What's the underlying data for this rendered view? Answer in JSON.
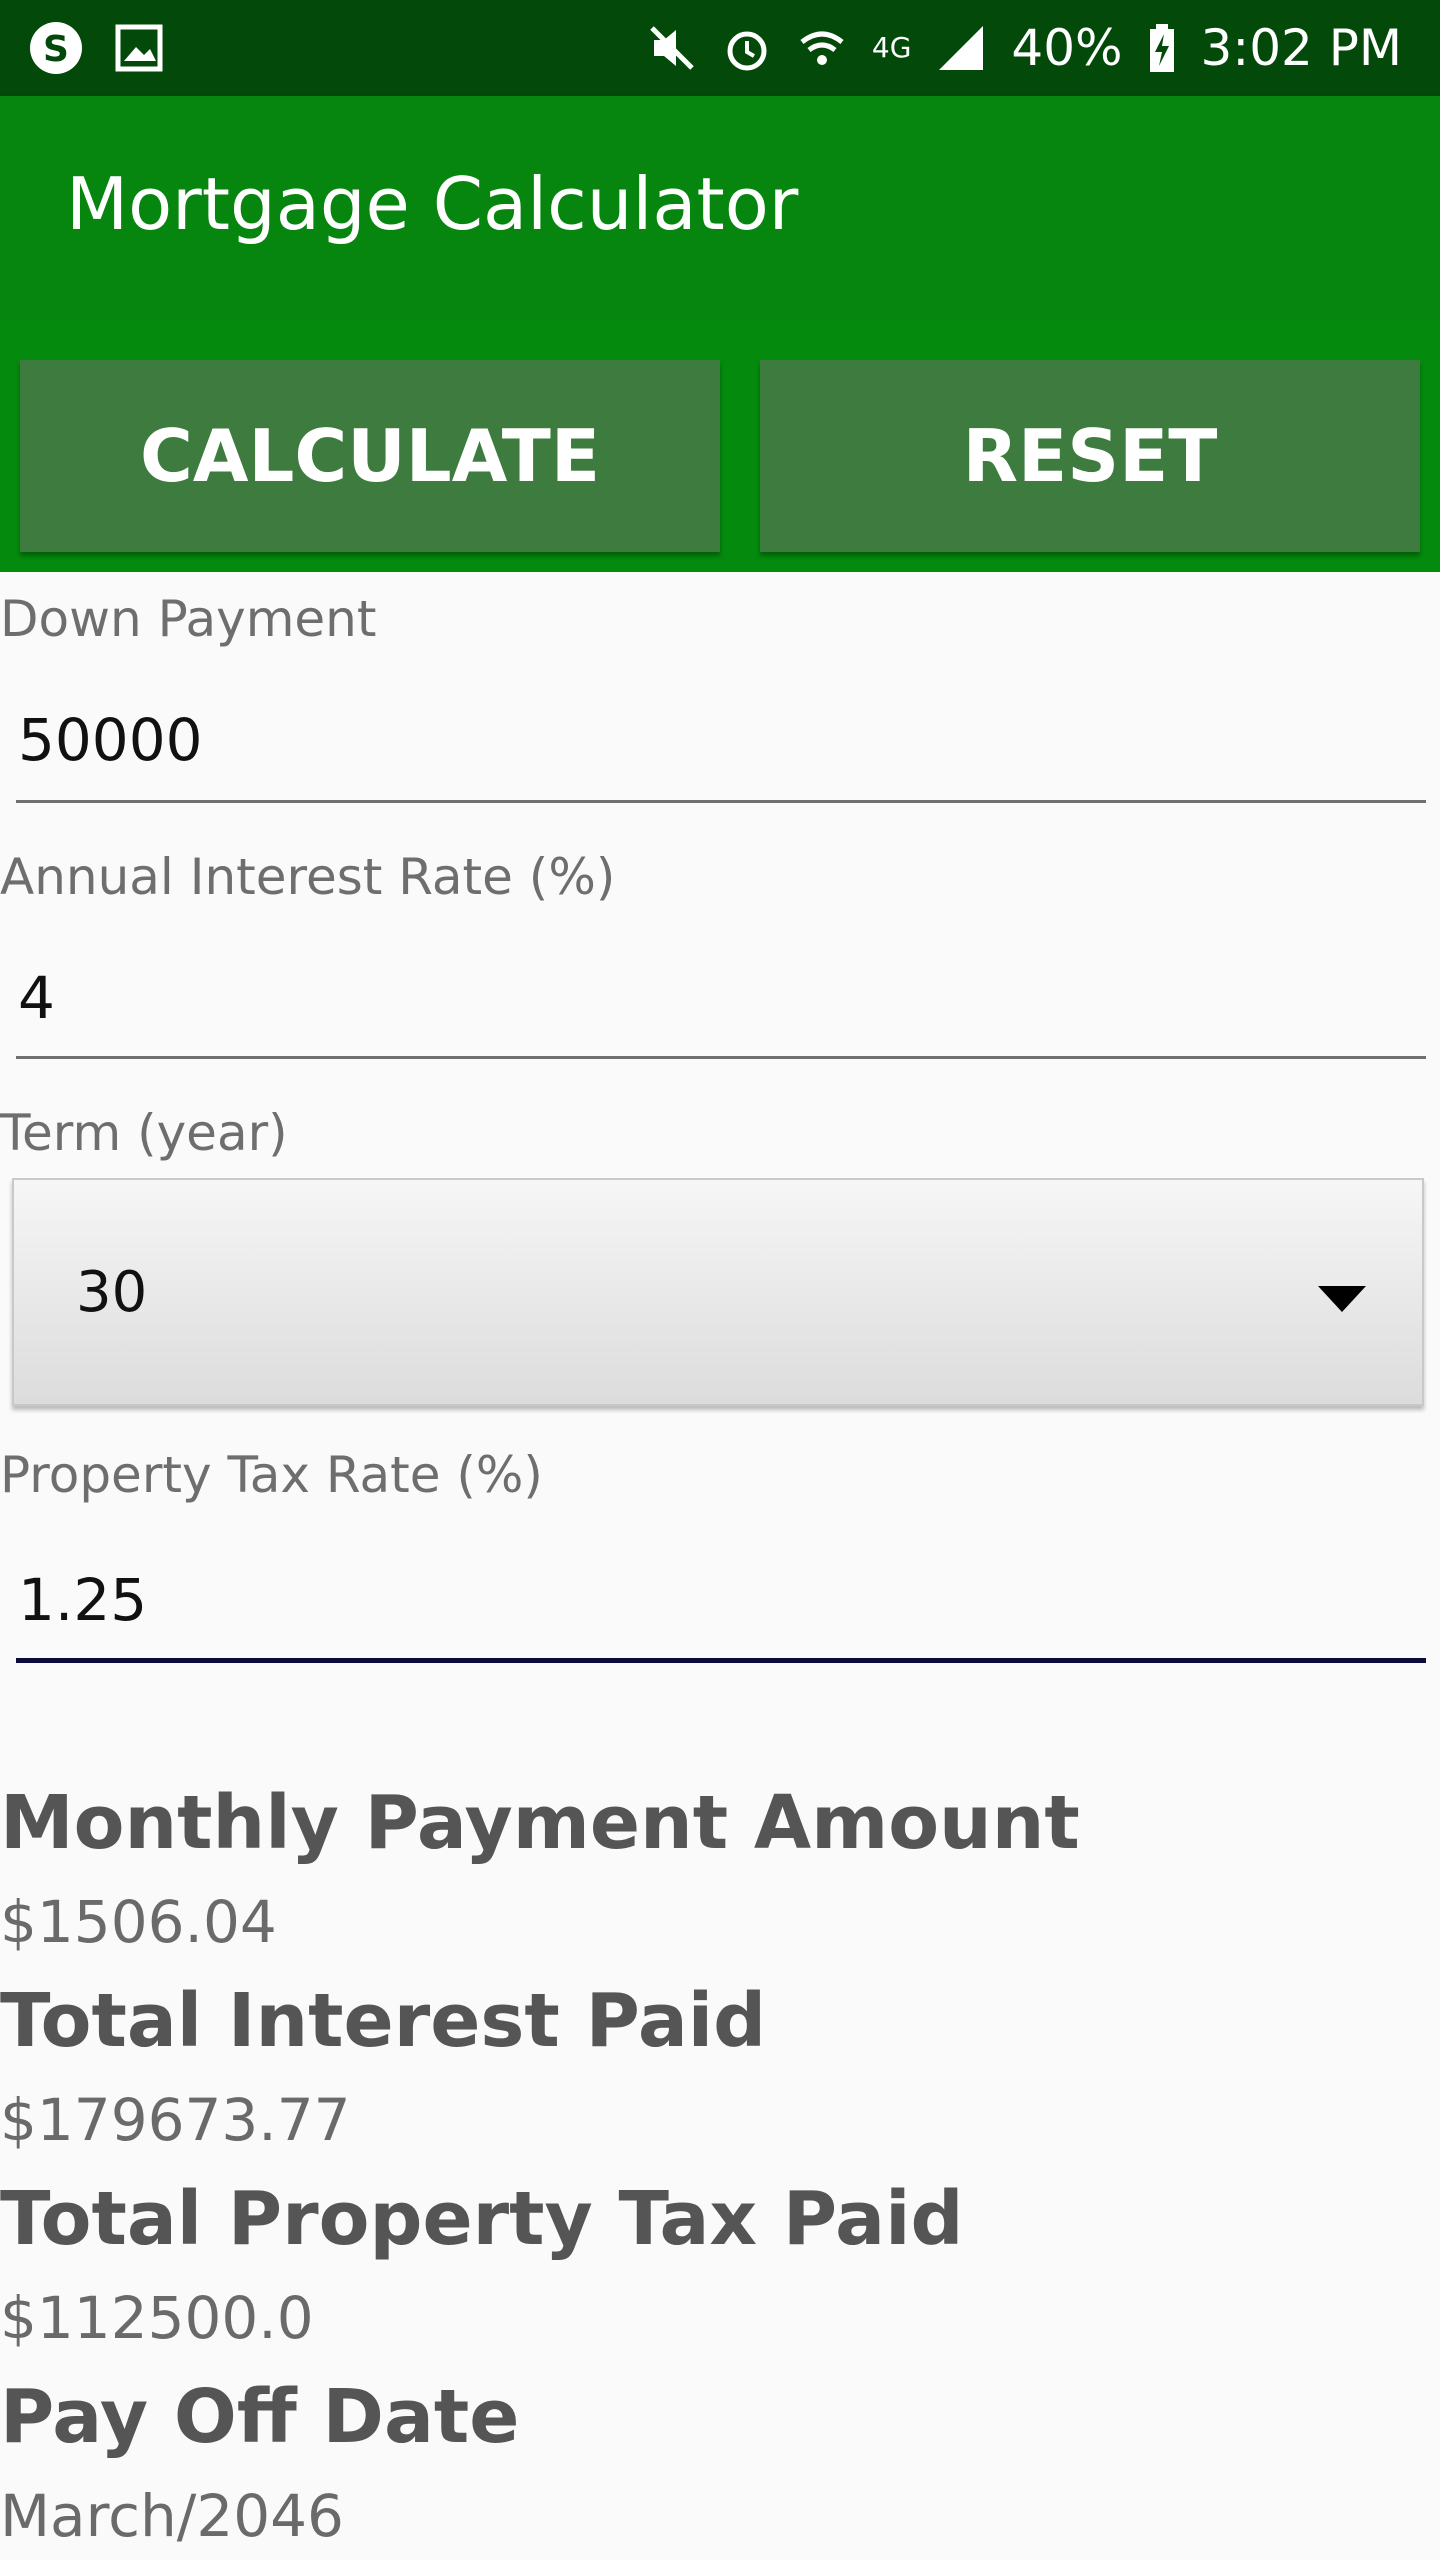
{
  "status_bar": {
    "icons_left": [
      "skype-icon",
      "image-icon"
    ],
    "icons_right": [
      "mute-icon",
      "alarm-icon",
      "wifi-icon",
      "lte-icon",
      "signal-icon"
    ],
    "battery": "40%",
    "time": "3:02 PM",
    "network_label": "4G"
  },
  "app_bar": {
    "title": "Mortgage Calculator"
  },
  "buttons": {
    "calculate": "CALCULATE",
    "reset": "RESET"
  },
  "form": {
    "down_payment": {
      "label": "Down Payment",
      "value": "50000"
    },
    "interest_rate": {
      "label": "Annual Interest Rate (%)",
      "value": "4"
    },
    "term": {
      "label": "Term (year)",
      "value": "30"
    },
    "property_tax": {
      "label": "Property Tax Rate (%)",
      "value": "1.25"
    }
  },
  "results": {
    "monthly_payment": {
      "title": "Monthly Payment Amount",
      "value": "$1506.04"
    },
    "total_interest": {
      "title": "Total Interest Paid",
      "value": "$179673.77"
    },
    "total_property_tax": {
      "title": "Total Property Tax Paid",
      "value": "$112500.0"
    },
    "pay_off_date": {
      "title": "Pay Off Date",
      "value": "March/2046"
    }
  },
  "colors": {
    "status_bar": "#034a0a",
    "app_bar": "#06860f",
    "button_bar": "#048a0c",
    "button": "#3d7b3f"
  }
}
